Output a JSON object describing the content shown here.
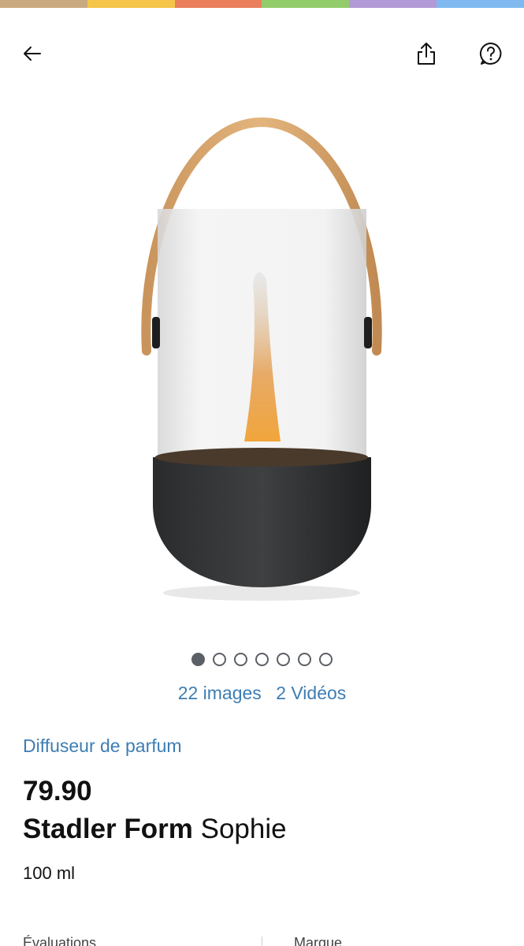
{
  "color_strip": [
    "#c9a97f",
    "#f5c54a",
    "#ea7e5d",
    "#93cc6a",
    "#b19ad6",
    "#7fb9ef"
  ],
  "header": {
    "back_icon": "arrow-left-icon",
    "share_icon": "share-icon",
    "help_icon": "question-bubble-icon"
  },
  "gallery": {
    "dot_count": 7,
    "active_index": 0,
    "images_label": "22 images",
    "videos_label": "2 Vidéos"
  },
  "product": {
    "category": "Diffuseur de parfum",
    "price": "79.90",
    "brand": "Stadler Form",
    "name": "Sophie",
    "size": "100 ml"
  },
  "bottom_tabs": {
    "left": "Évaluations",
    "right": "Marque"
  }
}
